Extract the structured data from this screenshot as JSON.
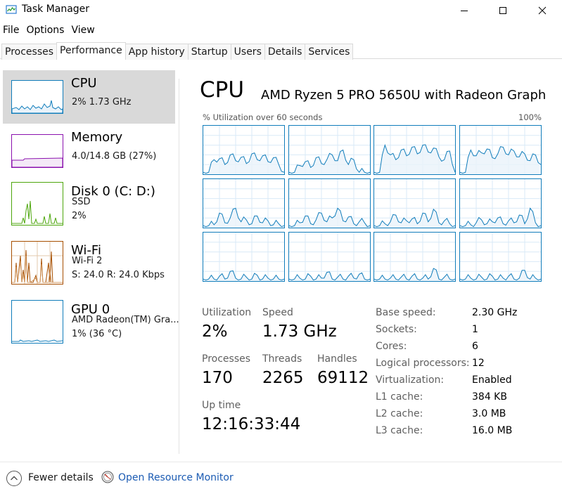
{
  "window": {
    "title": "Task Manager",
    "icon": "task-manager-icon"
  },
  "menu": [
    "File",
    "Options",
    "View"
  ],
  "tabs": [
    {
      "label": "Processes",
      "active": false
    },
    {
      "label": "Performance",
      "active": true
    },
    {
      "label": "App history",
      "active": false
    },
    {
      "label": "Startup",
      "active": false
    },
    {
      "label": "Users",
      "active": false
    },
    {
      "label": "Details",
      "active": false
    },
    {
      "label": "Services",
      "active": false
    }
  ],
  "sidebar": {
    "items": [
      {
        "title": "CPU",
        "line1": "2%  1.73 GHz",
        "line2": "",
        "color": "#117dbb",
        "active": true
      },
      {
        "title": "Memory",
        "line1": "4.0/14.8 GB (27%)",
        "line2": "",
        "color": "#8b12ae",
        "active": false
      },
      {
        "title": "Disk 0 (C: D:)",
        "line1": "SSD",
        "line2": "2%",
        "color": "#4da60c",
        "active": false
      },
      {
        "title": "Wi-Fi",
        "line1": "Wi-Fi 2",
        "line2": "S: 24.0  R: 24.0 Kbps",
        "color": "#a74f01",
        "active": false
      },
      {
        "title": "GPU 0",
        "line1": "AMD Radeon(TM) Gra...",
        "line2": "1% (36 °C)",
        "color": "#117dbb",
        "active": false
      }
    ]
  },
  "main": {
    "title": "CPU",
    "model": "AMD Ryzen 5 PRO 5650U with Radeon Graph...",
    "util_label": "% Utilization over 60 seconds",
    "util_max": "100%",
    "graph_color": "#117dbb",
    "stats": {
      "utilization_label": "Utilization",
      "utilization": "2%",
      "speed_label": "Speed",
      "speed": "1.73 GHz",
      "processes_label": "Processes",
      "processes": "170",
      "threads_label": "Threads",
      "threads": "2265",
      "handles_label": "Handles",
      "handles": "69112",
      "uptime_label": "Up time",
      "uptime": "12:16:33:44"
    },
    "specs": [
      {
        "key": "Base speed:",
        "value": "2.30 GHz"
      },
      {
        "key": "Sockets:",
        "value": "1"
      },
      {
        "key": "Cores:",
        "value": "6"
      },
      {
        "key": "Logical processors:",
        "value": "12"
      },
      {
        "key": "Virtualization:",
        "value": "Enabled"
      },
      {
        "key": "L1 cache:",
        "value": "384 KB"
      },
      {
        "key": "L2 cache:",
        "value": "3.0 MB"
      },
      {
        "key": "L3 cache:",
        "value": "16.0 MB"
      }
    ]
  },
  "footer": {
    "fewer_details": "Fewer details",
    "open_resource_monitor": "Open Resource Monitor"
  }
}
